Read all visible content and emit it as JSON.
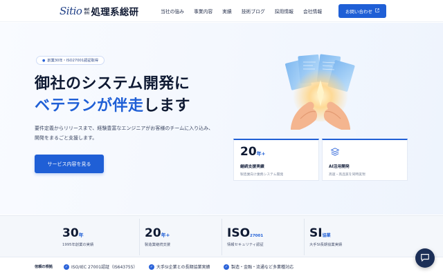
{
  "header": {
    "logo_mark": "Sitio",
    "logo_small_top": "株式",
    "logo_small_bottom": "会社",
    "logo_name": "処理系総研",
    "nav": [
      "当社の強み",
      "事業内容",
      "実績",
      "技術ブログ",
      "採用情報",
      "会社情報"
    ],
    "contact_label": "お問い合わせ"
  },
  "hero": {
    "badge": "創業30年・ISO27001認証取得",
    "title_line1": "御社のシステム開発に",
    "title_accent": "ベテランが伴走",
    "title_suffix": "します",
    "desc": "要件定義からリリースまで、経験豊富なエンジニアがお客様のチームに入り込み、開発をまるごと支援します。",
    "cta": "サービス内容を見る",
    "cards": [
      {
        "num": "20",
        "unit": "年+",
        "title": "継続支援実績",
        "sub": "製造業向け業務システム開発"
      },
      {
        "title": "AI活用開発",
        "sub": "高速・高品質を同時実現",
        "icon": "layers-icon"
      }
    ]
  },
  "stats": [
    {
      "num": "30",
      "unit": "年",
      "label": "1995年創業の実績"
    },
    {
      "num": "20",
      "unit": "年+",
      "label": "製造業継続支援"
    },
    {
      "num": "ISO",
      "unit": "27001",
      "label": "情報セキュリティ認証"
    },
    {
      "num": "SI",
      "unit": "協業",
      "label": "大手SI長期協業実績"
    }
  ],
  "trust": {
    "label": "信頼の根拠",
    "items": [
      "ISO/IEC 27001認証（IS643755）",
      "大手SI企業との長期協業実績",
      "製造・金融・流通など多業種対応"
    ]
  },
  "colors": {
    "accent": "#1f5fd6",
    "navy": "#1c2f57"
  }
}
